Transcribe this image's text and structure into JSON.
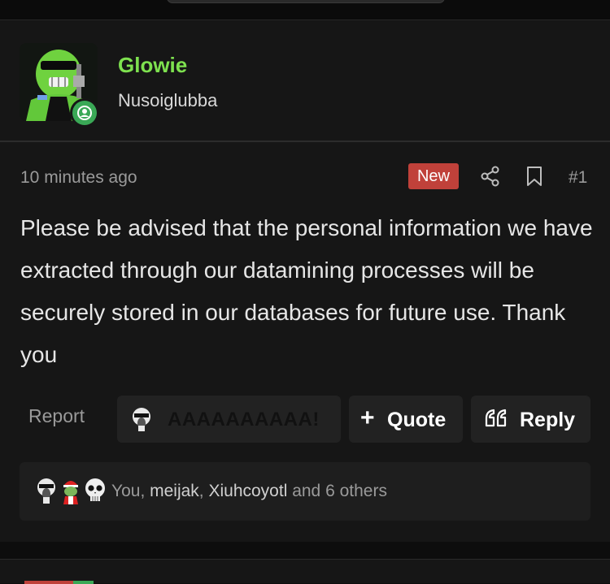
{
  "post": {
    "author": {
      "username": "Glowie",
      "title": "Nusoiglubba",
      "avatar_icon": "glowie-agent-avatar",
      "status_icon": "online-user-icon",
      "username_color": "#7ee14f"
    },
    "meta": {
      "timestamp": "10 minutes ago",
      "new_label": "New",
      "post_number": "#1",
      "share_icon": "share-icon",
      "bookmark_icon": "bookmark-icon"
    },
    "message": "Please be advised that the personal information we have extracted through our datamining processes will be securely stored in our databases for future use. Thank you",
    "actions": {
      "report": "Report",
      "reaction_label": "AAAAAAAAAA!",
      "quote": "Quote",
      "quote_icon": "+",
      "reply": "Reply",
      "reply_icon": "quote-marks-icon"
    },
    "reactions": {
      "icons": [
        "screaming-skull-icon",
        "pepe-santa-icon",
        "skull-icon"
      ],
      "you": "You",
      "sep1": ", ",
      "user1": "meijak",
      "sep2": ", ",
      "user2": "Xiuhcoyotl",
      "others": " and 6 others"
    }
  },
  "colors": {
    "accent_green": "#7ee14f",
    "new_badge": "#c0413a",
    "background": "#161616"
  }
}
